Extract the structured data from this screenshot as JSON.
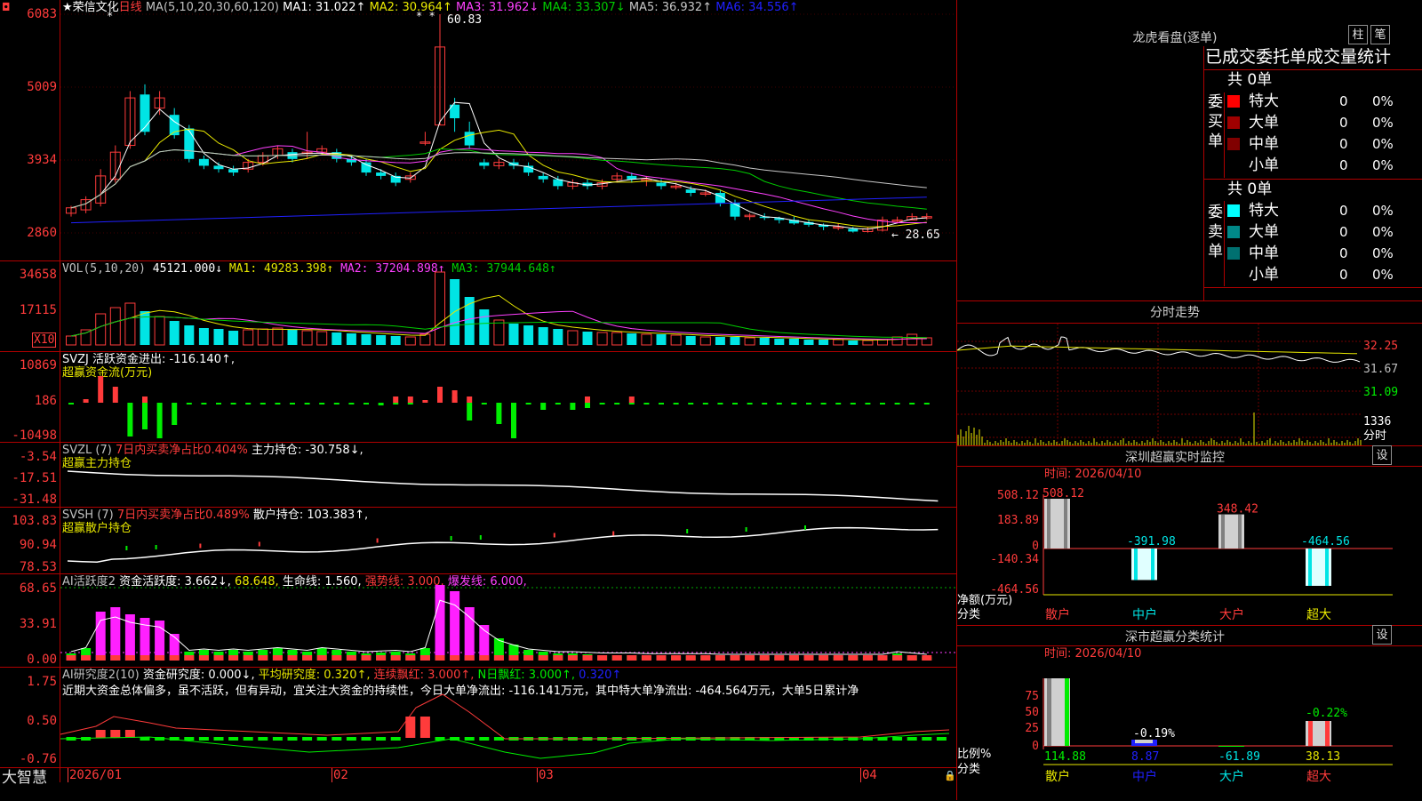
{
  "colors": {
    "up": "#ff3b3b",
    "down": "#00e5e5",
    "ma1": "#ffffff",
    "ma2": "#e8e800",
    "ma3": "#ff40ff",
    "ma4": "#00cc00",
    "ma5": "#c8c8c8",
    "ma6": "#2020ff",
    "grid": "#b00000",
    "green": "#00ee00",
    "magenta": "#ff20ff"
  },
  "header": {
    "star": "★",
    "stock_name": "荣信文化",
    "period": "日线",
    "ma_params": "MA(5,10,20,30,60,120)",
    "ma1": "MA1: 31.022↑",
    "ma2": "MA2: 30.964↑",
    "ma3": "MA3: 31.962↓",
    "ma4": "MA4: 33.307↓",
    "ma5": "MA5: 36.932↑",
    "ma6": "MA6: 34.556↑",
    "high_marker": "60.83",
    "low_marker": "← 28.65"
  },
  "price_axis": [
    "6083",
    "5009",
    "3934",
    "2860"
  ],
  "vol": {
    "legend_name": "VOL(5,10,20)",
    "legend_val": "45121.000↓",
    "ma1": "MA1: 49283.398↑",
    "ma2": "MA2: 37204.898↑",
    "ma3": "MA3: 37944.648↑",
    "axis": [
      "34658",
      "17115"
    ],
    "unit": "X10"
  },
  "svzj": {
    "legend": "SVZJ  活跃资金进出: -116.140↑,",
    "sub": "超赢资金流(万元)",
    "axis": [
      "10869",
      "186",
      "-10498"
    ]
  },
  "svzl": {
    "legend_a": "SVZL (7)",
    "legend_b": "7日内买卖净占比0.404%",
    "legend_c": "主力持仓: -30.758↓,",
    "sub": "超赢主力持仓",
    "axis": [
      "-3.54",
      "-17.51",
      "-31.48"
    ]
  },
  "svsh": {
    "legend_a": "SVSH (7)",
    "legend_b": "7日内买卖净占比0.489%",
    "legend_c": "散户持仓: 103.383↑,",
    "sub": "超赢散户持仓",
    "axis": [
      "103.83",
      "90.94",
      "78.53"
    ]
  },
  "ai_active": {
    "legend_a": "AI活跃度2",
    "legend_b": "资金活跃度: 3.662↓,",
    "legend_c": "68.648,",
    "legend_d": "生命线: 1.560,",
    "legend_e": "强势线: 3.000,",
    "legend_f": "爆发线: 6.000,",
    "axis": [
      "68.65",
      "33.91",
      "0.00"
    ]
  },
  "ai_research": {
    "legend_a": "AI研究度2(10)",
    "legend_b": "资金研究度: 0.000↓,",
    "legend_c": "平均研究度: 0.320↑,",
    "legend_d": "连续飘红: 3.000↑,",
    "legend_e": "N日飘红: 3.000↑,",
    "legend_f": "0.320↑",
    "comment": "近期大资金总体偏多，虽不活跃，但有异动，宜关注大资金的持续性，今日大单净流出: -116.141万元，其中特大单净流出: -464.564万元，大单5日累计净",
    "axis": [
      "1.75",
      "0.50",
      "-0.76"
    ]
  },
  "bottom": {
    "brand": "大智慧",
    "dates": [
      "2026/01",
      "02",
      "03",
      "04"
    ]
  },
  "right": {
    "lhb_title": "龙虎看盘(逐单)",
    "btn_col": "柱",
    "btn_pen": "笔",
    "tabs_text": "已成交委托单成交量统计",
    "buy_total": "共 0单",
    "buy_label": "委买单",
    "sell_total": "共 0单",
    "sell_label": "委卖单",
    "buy_rows": [
      {
        "name": "特大",
        "count": "0",
        "pct": "0%",
        "color": "#ff0000"
      },
      {
        "name": "大单",
        "count": "0",
        "pct": "0%",
        "color": "#a00000"
      },
      {
        "name": "中单",
        "count": "0",
        "pct": "0%",
        "color": "#800000"
      },
      {
        "name": "小单",
        "count": "0",
        "pct": "0%",
        "color": ""
      }
    ],
    "sell_rows": [
      {
        "name": "特大",
        "count": "0",
        "pct": "0%",
        "color": "#00ffff"
      },
      {
        "name": "大单",
        "count": "0",
        "pct": "0%",
        "color": "#008888"
      },
      {
        "name": "中单",
        "count": "0",
        "pct": "0%",
        "color": "#007070"
      },
      {
        "name": "小单",
        "count": "0",
        "pct": "0%",
        "color": ""
      }
    ],
    "intraday_title": "分时走势",
    "intraday_axis": [
      "32.25",
      "31.67",
      "31.09"
    ],
    "intraday_vol": "1336",
    "intraday_unit": "分时",
    "monitor_title": "深圳超赢实时监控",
    "monitor_set": "设",
    "monitor_time": "时间: 2026/04/10",
    "monitor_axis": [
      "508.12",
      "183.89",
      "0",
      "-140.34",
      "-464.56"
    ],
    "monitor_ylabel": "净额(万元)",
    "monitor_xlabel": "分类",
    "monitor_cats": [
      "散户",
      "中户",
      "大户",
      "超大"
    ],
    "monitor_vals": [
      "508.12",
      "-391.98",
      "348.42",
      "-464.56"
    ],
    "stat_title": "深市超赢分类统计",
    "stat_set": "设",
    "stat_time": "时间: 2026/04/10",
    "stat_axis": [
      "75",
      "50",
      "25",
      "0"
    ],
    "stat_ylabel": "比例%",
    "stat_xlabel": "分类",
    "stat_cats": [
      "散户",
      "中户",
      "大户",
      "超大"
    ],
    "stat_vals": [
      "114.88",
      "8.87",
      "-61.89",
      "38.13"
    ],
    "stat_notes": [
      "-0.19%",
      "-0.22%"
    ]
  },
  "chart_data": {
    "type": "candlestick",
    "title": "荣信文化 日线",
    "ylim": [
      2860,
      6083
    ],
    "candles": [
      [
        3150,
        3230,
        3100,
        3260
      ],
      [
        3200,
        3350,
        3150,
        3400
      ],
      [
        3300,
        3700,
        3250,
        3800
      ],
      [
        3650,
        4050,
        3600,
        4150
      ],
      [
        4150,
        4850,
        4100,
        4950
      ],
      [
        4900,
        4350,
        4300,
        5050
      ],
      [
        4700,
        4850,
        4600,
        4950
      ],
      [
        4600,
        4300,
        4250,
        4700
      ],
      [
        4400,
        3950,
        3900,
        4450
      ],
      [
        3950,
        3850,
        3800,
        4000
      ],
      [
        3850,
        3800,
        3750,
        3900
      ],
      [
        3800,
        3750,
        3700,
        3850
      ],
      [
        3800,
        3900,
        3750,
        3950
      ],
      [
        3900,
        4000,
        3850,
        4050
      ],
      [
        4000,
        4100,
        3950,
        4150
      ],
      [
        4050,
        3950,
        3900,
        4100
      ],
      [
        4050,
        4050,
        3950,
        4350
      ],
      [
        4050,
        4100,
        4000,
        4150
      ],
      [
        4050,
        3950,
        3900,
        4100
      ],
      [
        3950,
        3900,
        3850,
        4000
      ],
      [
        3900,
        3750,
        3700,
        3950
      ],
      [
        3750,
        3700,
        3650,
        3800
      ],
      [
        3700,
        3600,
        3550,
        3750
      ],
      [
        3650,
        3700,
        3600,
        3750
      ],
      [
        4200,
        4200,
        4150,
        4350
      ],
      [
        4450,
        5600,
        4450,
        6083
      ],
      [
        4750,
        4550,
        4350,
        4850
      ],
      [
        4350,
        4150,
        4100,
        4500
      ],
      [
        3900,
        3850,
        3800,
        3950
      ],
      [
        3850,
        3900,
        3800,
        3950
      ],
      [
        3900,
        3850,
        3800,
        3950
      ],
      [
        3850,
        3750,
        3700,
        3900
      ],
      [
        3700,
        3650,
        3600,
        3750
      ],
      [
        3650,
        3550,
        3500,
        3700
      ],
      [
        3550,
        3600,
        3500,
        3650
      ],
      [
        3600,
        3550,
        3500,
        3650
      ],
      [
        3550,
        3600,
        3500,
        3650
      ],
      [
        3650,
        3700,
        3600,
        3750
      ],
      [
        3700,
        3650,
        3600,
        3750
      ],
      [
        3650,
        3650,
        3550,
        3700
      ],
      [
        3600,
        3550,
        3500,
        3650
      ],
      [
        3550,
        3550,
        3500,
        3600
      ],
      [
        3500,
        3450,
        3400,
        3550
      ],
      [
        3450,
        3450,
        3400,
        3500
      ],
      [
        3450,
        3300,
        3250,
        3500
      ],
      [
        3300,
        3100,
        3050,
        3350
      ],
      [
        3100,
        3120,
        3050,
        3150
      ],
      [
        3100,
        3080,
        3050,
        3150
      ],
      [
        3080,
        3050,
        3000,
        3100
      ],
      [
        3050,
        3000,
        2980,
        3100
      ],
      [
        3020,
        2980,
        2950,
        3050
      ],
      [
        2980,
        2950,
        2900,
        3000
      ],
      [
        2950,
        2950,
        2900,
        3000
      ],
      [
        2920,
        2880,
        2865,
        2950
      ],
      [
        2880,
        2920,
        2865,
        2950
      ],
      [
        2900,
        3050,
        2880,
        3100
      ],
      [
        3050,
        3050,
        3000,
        3100
      ],
      [
        3050,
        3100,
        3050,
        3150
      ],
      [
        3080,
        3100,
        3050,
        3150
      ]
    ]
  }
}
